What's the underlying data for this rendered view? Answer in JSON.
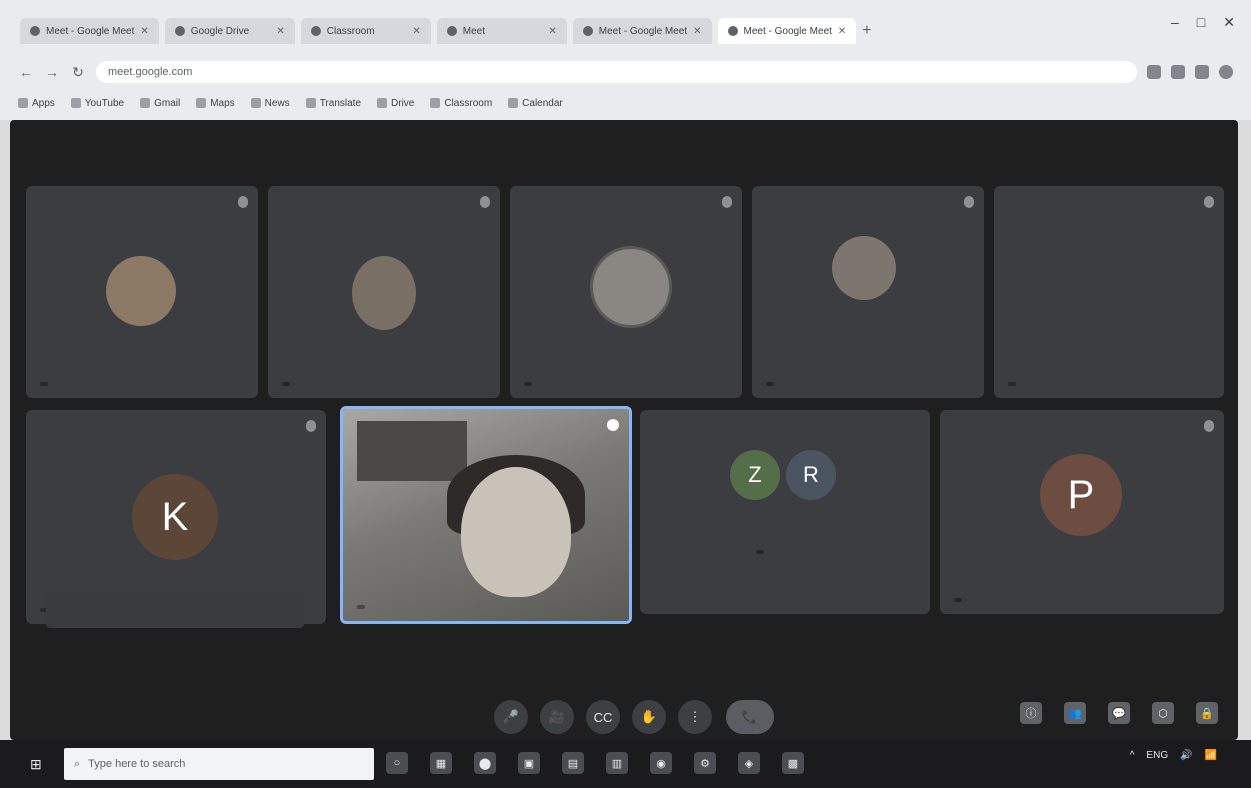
{
  "browser": {
    "tabs": [
      {
        "label": "Meet - Google Meet",
        "active": false
      },
      {
        "label": "Google Drive",
        "active": false
      },
      {
        "label": "Classroom",
        "active": false
      },
      {
        "label": "Meet",
        "active": false
      },
      {
        "label": "Meet - Google Meet",
        "active": false
      },
      {
        "label": "Meet - Google Meet",
        "active": true
      }
    ],
    "new_tab": "+",
    "window_controls": {
      "minimize": "–",
      "maximize": "□",
      "close": "✕"
    },
    "nav": {
      "back": "←",
      "forward": "→",
      "reload": "↻"
    },
    "url": "meet.google.com",
    "bookmarks": [
      "Apps",
      "YouTube",
      "Gmail",
      "Maps",
      "News",
      "Translate",
      "Drive",
      "Classroom",
      "Calendar"
    ]
  },
  "meet": {
    "tiles_row1": [
      {
        "name": "",
        "kind": "photo",
        "avatar_color": "#8c7a66"
      },
      {
        "name": "",
        "kind": "photo",
        "avatar_color": "#7a6f64"
      },
      {
        "name": "",
        "kind": "photo",
        "avatar_color": "#8a8782"
      },
      {
        "name": "",
        "kind": "photo",
        "avatar_color": "#7c766e"
      },
      {
        "name": "",
        "kind": "blank",
        "avatar_color": "#3c3d40"
      }
    ],
    "tiles_row2": [
      {
        "name": "",
        "kind": "letter",
        "letter": "K",
        "avatar_color": "#5b4637"
      },
      {
        "name": "",
        "kind": "video"
      },
      {
        "name": "",
        "kind": "double",
        "letters": [
          "Z",
          "R"
        ],
        "avatar_colors": [
          "#546e4a",
          "#4a5561"
        ]
      },
      {
        "name": "",
        "kind": "letter",
        "letter": "P",
        "avatar_color": "#6d4c41"
      }
    ],
    "toast": "",
    "tile4_note": "",
    "bottom": {
      "time": "",
      "meeting_title": "",
      "controls": [
        "🎤",
        "🎥",
        "CC",
        "✋",
        "⋮",
        "📞"
      ],
      "right_controls": [
        "ⓘ",
        "👥",
        "💬",
        "⬡",
        "🔒"
      ],
      "right_label": ""
    }
  },
  "taskbar": {
    "start": "⊞",
    "search_placeholder": "Type here to search",
    "apps": [
      "○",
      "▦",
      "⬤",
      "▣",
      "▤",
      "▥",
      "◉",
      "⚙",
      "◈",
      "▩"
    ],
    "tray": [
      "^",
      "ENG",
      "🔊",
      "📶"
    ],
    "clock": ""
  }
}
